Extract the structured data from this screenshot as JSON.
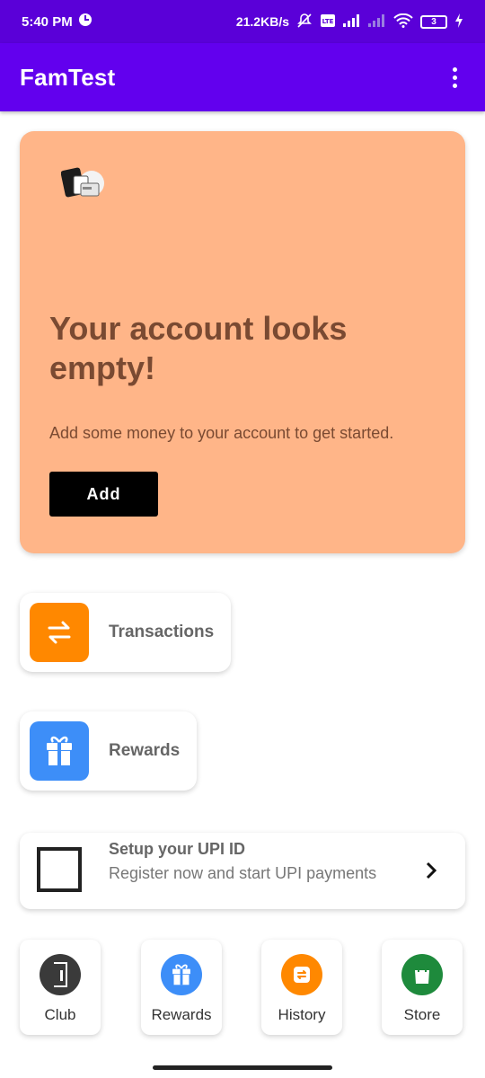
{
  "status_bar": {
    "time": "5:40 PM",
    "network_speed": "21.2KB/s",
    "battery_level": "3",
    "icons": [
      "clock-circle-icon",
      "mute-bell-icon",
      "volte-icon",
      "signal-icon",
      "signal-empty-icon",
      "wifi-icon",
      "battery-icon",
      "charging-icon"
    ]
  },
  "app_bar": {
    "title": "FamTest",
    "menu_icon": "overflow-menu-icon"
  },
  "hero": {
    "title": "Your account looks empty!",
    "subtitle": "Add some money to your account to get started.",
    "button_label": "Add",
    "background_color": "#ffb588",
    "text_color": "#7a4a32",
    "illustration_icon": "card-illustration-icon"
  },
  "features": [
    {
      "label": "Transactions",
      "icon": "transfer-arrows-icon",
      "color": "#ff8800"
    },
    {
      "label": "Rewards",
      "icon": "gift-icon",
      "color": "#3d8ef8"
    }
  ],
  "upi": {
    "title": "Setup your UPI ID",
    "subtitle": "Register now and start UPI payments",
    "chevron_icon": "chevron-right-icon"
  },
  "bottom_nav": [
    {
      "label": "Club",
      "icon": "door-icon",
      "color": "#3a3a3a"
    },
    {
      "label": "Rewards",
      "icon": "gift-icon",
      "color": "#3d8ef8"
    },
    {
      "label": "History",
      "icon": "transfer-arrows-icon",
      "color": "#ff8800"
    },
    {
      "label": "Store",
      "icon": "shopping-bag-icon",
      "color": "#1e8a3c"
    }
  ],
  "colors": {
    "status_bar": "#5a00d8",
    "app_bar": "#6200ee",
    "add_button": "#000000"
  }
}
